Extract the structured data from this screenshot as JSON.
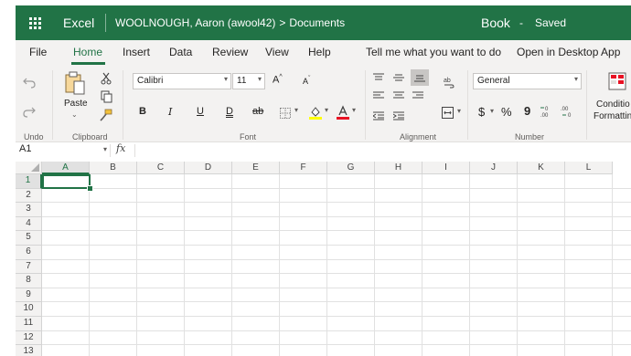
{
  "titlebar": {
    "app_name": "Excel",
    "user": "WOOLNOUGH, Aaron (awool42)",
    "chevron": ">",
    "folder": "Documents",
    "book_name": "Book",
    "dash": "-",
    "save_status": "Saved",
    "bg_color": "#217346"
  },
  "menu": {
    "tabs": [
      "File",
      "Home",
      "Insert",
      "Data",
      "Review",
      "View",
      "Help",
      "Tell me what you want to do",
      "Open in Desktop App"
    ],
    "active_tab": "Home"
  },
  "ribbon": {
    "groups": {
      "undo": "Undo",
      "clipboard": "Clipboard",
      "font": "Font",
      "alignment": "Alignment",
      "number": "Number"
    },
    "paste_label": "Paste",
    "font_name": "Calibri",
    "font_size": "11",
    "grow_font": "A",
    "shrink_font": "A",
    "bold": "B",
    "italic": "I",
    "underline": "U",
    "double_underline": "D",
    "strikethrough": "ab",
    "number_format": "General",
    "currency": "$",
    "percent": "%",
    "comma": "9",
    "inc_decimal": "⁺⁰⁄.₀₀",
    "dec_decimal": ".⁰⁰⁄₊₀",
    "conditional_1": "Conditio",
    "conditional_2": "Formattin"
  },
  "formula_bar": {
    "name_box": "A1",
    "fx": "fx"
  },
  "grid": {
    "columns": [
      "A",
      "B",
      "C",
      "D",
      "E",
      "F",
      "G",
      "H",
      "I",
      "J",
      "K",
      "L"
    ],
    "rows": [
      "1",
      "2",
      "3",
      "4",
      "5",
      "6",
      "7",
      "8",
      "9",
      "10",
      "11",
      "12",
      "13"
    ],
    "selected_cell": "A1"
  }
}
